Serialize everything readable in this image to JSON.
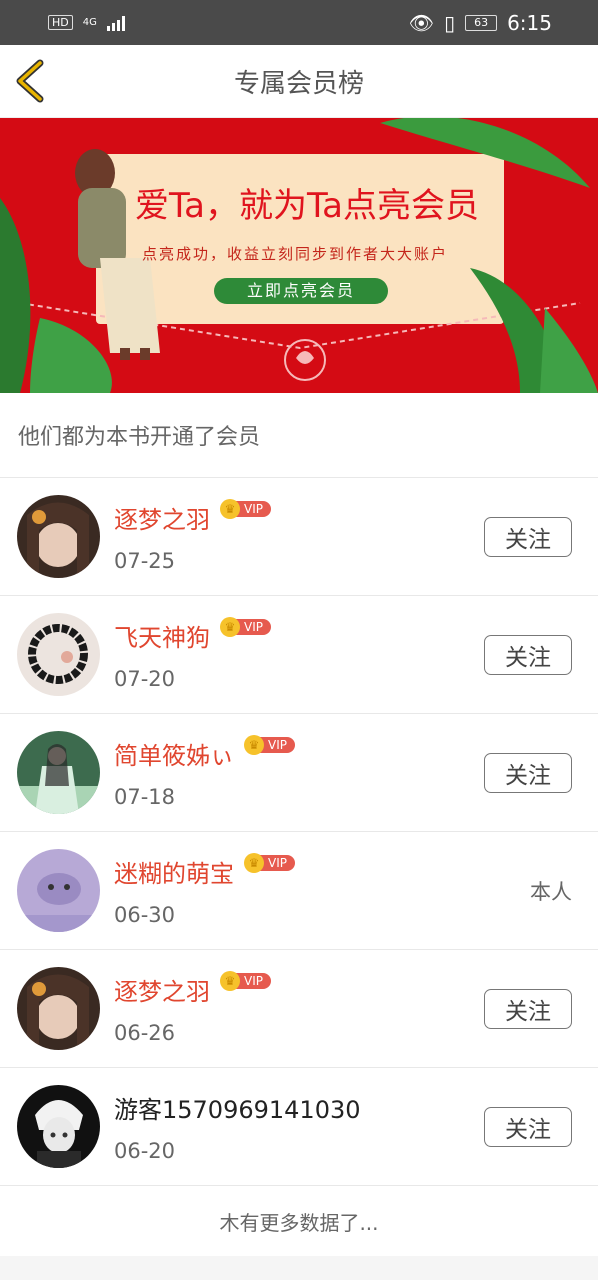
{
  "status_bar": {
    "hd": "HD",
    "network": "4G",
    "battery": "63",
    "time": "6:15"
  },
  "nav": {
    "title": "专属会员榜",
    "back_icon": "chevron-left-icon",
    "accent": "#e8b400"
  },
  "banner": {
    "headline": "爱Ta，就为Ta点亮会员",
    "subtitle": "点亮成功，收益立刻同步到作者大大账户",
    "cta": "立即点亮会员"
  },
  "section_header": "他们都为本书开通了会员",
  "members": [
    {
      "name": "逐梦之羽",
      "vip": "VIP",
      "date": "07-25",
      "action": "关注"
    },
    {
      "name": "飞天神狗",
      "vip": "VIP",
      "date": "07-20",
      "action": "关注"
    },
    {
      "name": "简单筱姊ぃ",
      "vip": "VIP",
      "date": "07-18",
      "action": "关注"
    },
    {
      "name": "迷糊的萌宝",
      "vip": "VIP",
      "date": "06-30",
      "action": "本人"
    },
    {
      "name": "逐梦之羽",
      "vip": "VIP",
      "date": "06-26",
      "action": "关注"
    },
    {
      "name": "游客1570969141030",
      "vip": "",
      "date": "06-20",
      "action": "关注"
    }
  ],
  "footer": "木有更多数据了..."
}
